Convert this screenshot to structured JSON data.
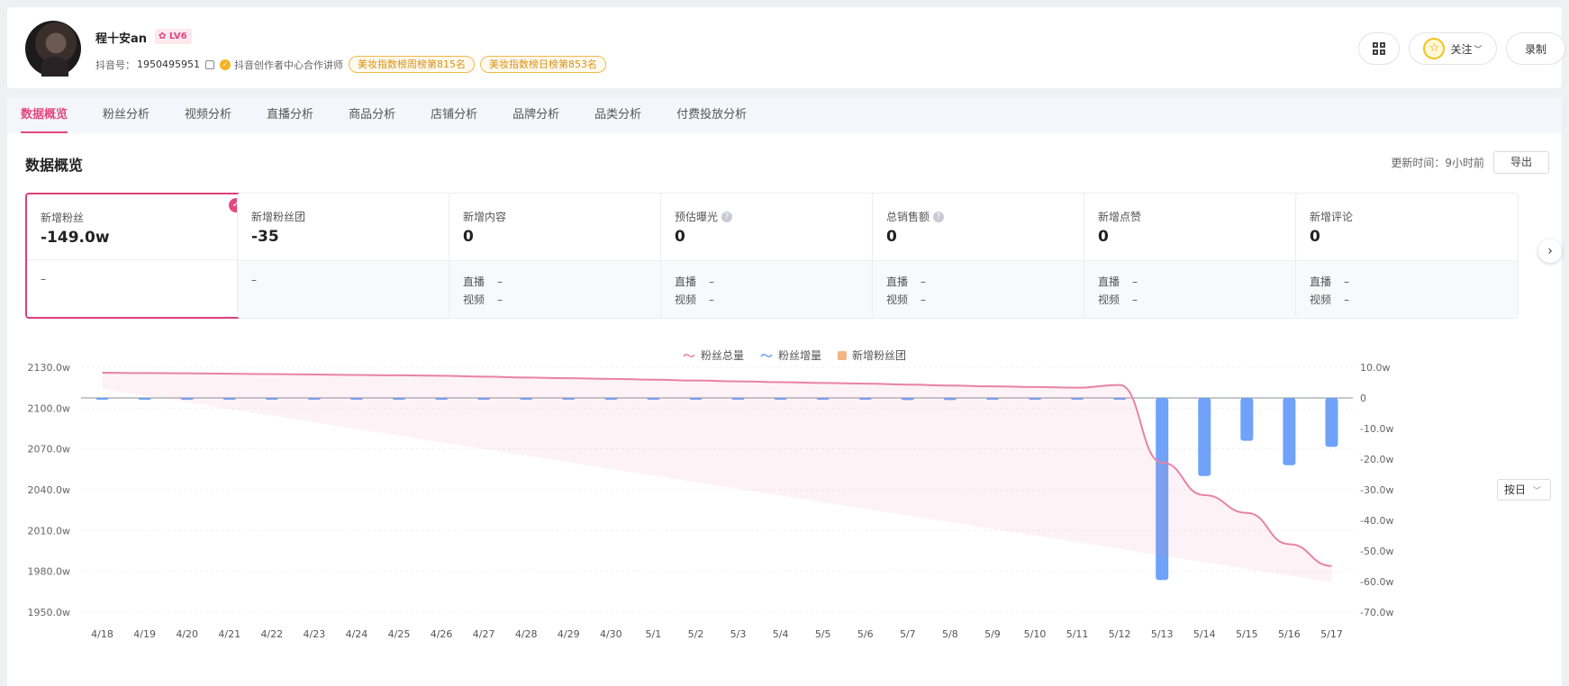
{
  "profile": {
    "name": "程十安an",
    "level": "LV6",
    "id_label": "抖音号：",
    "id_value": "1950495951",
    "verified_text": "抖音创作者中心合作讲师",
    "rank_week": "美妆指数榜周榜第815名",
    "rank_day": "美妆指数榜日榜第853名"
  },
  "header_actions": {
    "follow": "关注",
    "record": "录制"
  },
  "tabs": [
    "数据概览",
    "粉丝分析",
    "视频分析",
    "直播分析",
    "商品分析",
    "店铺分析",
    "品牌分析",
    "品类分析",
    "付费投放分析"
  ],
  "active_tab": 0,
  "overview": {
    "title": "数据概览",
    "update_label": "更新时间：",
    "update_value": "9小时前",
    "export": "导出"
  },
  "cards": [
    {
      "label": "新增粉丝",
      "value": "-149.0w",
      "help": false,
      "sub": [],
      "dash": "–"
    },
    {
      "label": "新增粉丝团",
      "value": "-35",
      "help": false,
      "sub": [],
      "dash": "–"
    },
    {
      "label": "新增内容",
      "value": "0",
      "help": false,
      "sub": [
        {
          "k": "直播",
          "v": "–"
        },
        {
          "k": "视频",
          "v": "–"
        }
      ]
    },
    {
      "label": "预估曝光",
      "value": "0",
      "help": true,
      "sub": [
        {
          "k": "直播",
          "v": "–"
        },
        {
          "k": "视频",
          "v": "–"
        }
      ]
    },
    {
      "label": "总销售额",
      "value": "0",
      "help": true,
      "sub": [
        {
          "k": "直播",
          "v": "–"
        },
        {
          "k": "视频",
          "v": "–"
        }
      ]
    },
    {
      "label": "新增点赞",
      "value": "0",
      "help": false,
      "sub": [
        {
          "k": "直播",
          "v": "–"
        },
        {
          "k": "视频",
          "v": "–"
        }
      ]
    },
    {
      "label": "新增评论",
      "value": "0",
      "help": false,
      "sub": [
        {
          "k": "直播",
          "v": "–"
        },
        {
          "k": "视频",
          "v": "–"
        }
      ]
    }
  ],
  "chart_selector": "按日",
  "colors": {
    "accent": "#e24a7d",
    "line": "#e882a6",
    "bar": "#6fa2f8",
    "fanclub": "#f3b485"
  },
  "chart_data": {
    "type": "line",
    "legend": [
      "粉丝总量",
      "粉丝增量",
      "新增粉丝团"
    ],
    "categories": [
      "4/18",
      "4/19",
      "4/20",
      "4/21",
      "4/22",
      "4/23",
      "4/24",
      "4/25",
      "4/26",
      "4/27",
      "4/28",
      "4/29",
      "4/30",
      "5/1",
      "5/2",
      "5/3",
      "5/4",
      "5/5",
      "5/6",
      "5/7",
      "5/8",
      "5/9",
      "5/10",
      "5/11",
      "5/12",
      "5/13",
      "5/14",
      "5/15",
      "5/16",
      "5/17"
    ],
    "left_axis": {
      "ticks": [
        "1950.0w",
        "1980.0w",
        "2010.0w",
        "2040.0w",
        "2070.0w",
        "2100.0w",
        "2130.0w"
      ],
      "ylim": [
        1950,
        2130
      ]
    },
    "right_axis": {
      "ticks": [
        "-70.0w",
        "-60.0w",
        "-50.0w",
        "-40.0w",
        "-30.0w",
        "-20.0w",
        "-10.0w",
        "0",
        "10.0w"
      ],
      "ylim": [
        -70,
        10
      ]
    },
    "series": [
      {
        "name": "粉丝总量",
        "axis": "left",
        "values": [
          2126.0,
          2125.8,
          2125.6,
          2125.3,
          2125.0,
          2124.7,
          2124.4,
          2124.1,
          2123.8,
          2123.1,
          2122.5,
          2122.0,
          2121.5,
          2120.9,
          2120.3,
          2119.7,
          2119.1,
          2118.5,
          2118.0,
          2117.3,
          2116.6,
          2116.0,
          2115.5,
          2115.0,
          2117.0,
          2060.0,
          2036.0,
          2023.0,
          2000.0,
          1984.0
        ]
      },
      {
        "name": "粉丝增量",
        "axis": "right",
        "type": "bar",
        "values": [
          -0.3,
          -0.3,
          -0.3,
          -0.3,
          -0.3,
          -0.3,
          -0.3,
          -0.3,
          -0.3,
          -0.6,
          -0.6,
          -0.5,
          -0.5,
          -0.6,
          -0.6,
          -0.6,
          -0.6,
          -0.6,
          -0.5,
          -0.7,
          -0.7,
          -0.6,
          -0.5,
          -0.5,
          -0.5,
          -59.5,
          -25.5,
          -14.0,
          -22.0,
          -16.0
        ]
      }
    ]
  }
}
